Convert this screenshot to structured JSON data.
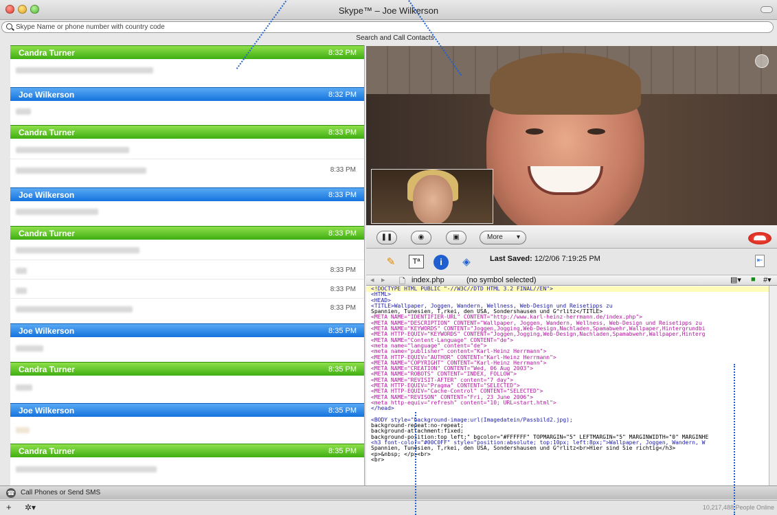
{
  "window": {
    "title": "Skype™ – Joe Wilkerson"
  },
  "search": {
    "placeholder": "Skype Name or phone number with country code",
    "caption": "Search and Call Contacts"
  },
  "chat": {
    "messages": [
      {
        "sender": "Candra Turner",
        "time": "8:32 PM",
        "color": "green"
      },
      {
        "sender": "Joe Wilkerson",
        "time": "8:32 PM",
        "color": "blue"
      },
      {
        "sender": "Candra Turner",
        "time": "8:33 PM",
        "color": "green",
        "line_times": [
          "8:33 PM"
        ]
      },
      {
        "sender": "Joe Wilkerson",
        "time": "8:33 PM",
        "color": "blue"
      },
      {
        "sender": "Candra Turner",
        "time": "8:33 PM",
        "color": "green",
        "line_times": [
          "8:33 PM",
          "8:33 PM",
          "8:33 PM"
        ]
      },
      {
        "sender": "Joe Wilkerson",
        "time": "8:35 PM",
        "color": "blue"
      },
      {
        "sender": "Candra Turner",
        "time": "8:35 PM",
        "color": "green"
      },
      {
        "sender": "Joe Wilkerson",
        "time": "8:35 PM",
        "color": "blue"
      },
      {
        "sender": "Candra Turner",
        "time": "8:35 PM",
        "color": "green"
      }
    ]
  },
  "call": {
    "more_label": "More"
  },
  "editor": {
    "last_saved_label": "Last Saved:",
    "last_saved_value": "12/2/06 7:19:25 PM",
    "file_name": "index.php",
    "symbol": "(no symbol selected)",
    "code_lines": [
      "<!DOCTYPE HTML PUBLIC \"-//W3C//DTD HTML 3.2 FINAL//EN\">",
      "<HTML>",
      "<HEAD>",
      "<TITLE>Wallpaper, Joggen, Wandern, Wellness, Web-Design und Reisetipps zu",
      "Spannien, Tunesien, T,rkei, den USA, Sondershausen und G^rlitz</TITLE>",
      "<META NAME=\"IDENTIFIER-URL\" CONTENT=\"http://www.karl-heinz-herrmann.de/index.php\">",
      "<META NAME=\"DESCRIPTION\" CONTENT=\"Wallpaper, Joggen, Wandern, Wellness, Web-Design und Reisetipps zu",
      "<META NAME=\"KEYWORDS\" CONTENT=\"Joggen,Jogging,Web-Design,Nachladen,Spamabwehr,Wallpaper,Hintergrundbi",
      "<META HTTP-EQUIV=\"KEYWORDS\" CONTENT=\"Joggen,Jogging,Web-Design,Nachladen,Spamabwehr,Wallpaper,Hinterg",
      "<META NAME=\"Content-Language\" CONTENT=\"de\">",
      "<meta name=\"language\" content=\"de\">",
      "<meta name=\"publisher\" content=\"Karl-Heinz Herrmann\">",
      "<META HTTP-EQUIV=\"AUTHOR\" CONTENT=\"Karl-Heinz Herrmann\">",
      "<META NAME=\"COPYRIGHT\" CONTENT=\"Karl-Heinz Herrmann\">",
      "<META NAME=\"CREATION\" CONTENT=\"Wed, 06 Aug 2003\">",
      "<META NAME=\"ROBOTS\" CONTENT=\"INDEX, FOLLOW\">",
      "<META NAME=\"REVISIT-AFTER\" content=\"7 day\">",
      "<META HTTP-EQUIV=\"Pragma\" CONTENT=\"SELECTED\">",
      "<META HTTP-EQUIV=\"Cache-Control\" CONTENT=\"SELECTED\">",
      "<META NAME=\"REVISON\" CONTENT=\"Fri, 23 June 2006\">",
      "<meta http-equiv=\"refresh\" content=\"10; URL=start.html\">",
      "</head>",
      "",
      "<BODY style=\"background-image:url(Imagedatein/Passbild2.jpg);",
      "background-repeat:no-repeat;",
      "background-attachment:fixed;",
      "background-position:top left;\" bgcolor=\"#FFFFFF\" TOPMARGIN=\"5\" LEFTMARGIN=\"5\" MARGINWIDTH=\"0\" MARGINHE",
      "<h3 font-color=\"#00C0FF\" style=\"position:absolute; top:10px; left:8px;\">Wallpaper, Joggen, Wandern, W",
      "Spannien, Tunesien, T,rkei, den USA, Sondershausen und G^rlitz<br>Hier sind Sie richtig</h3>",
      "<p>&nbsp; </p><br>",
      "<br>"
    ]
  },
  "bottom": {
    "call_phones_label": "Call Phones or Send SMS",
    "plus_label": "+",
    "gear_label": "✲▾",
    "online_label": "10,217,488 People Online"
  },
  "colors": {
    "green_header": "#3fae12",
    "blue_header": "#1473dd",
    "hangup": "#c4160b"
  }
}
